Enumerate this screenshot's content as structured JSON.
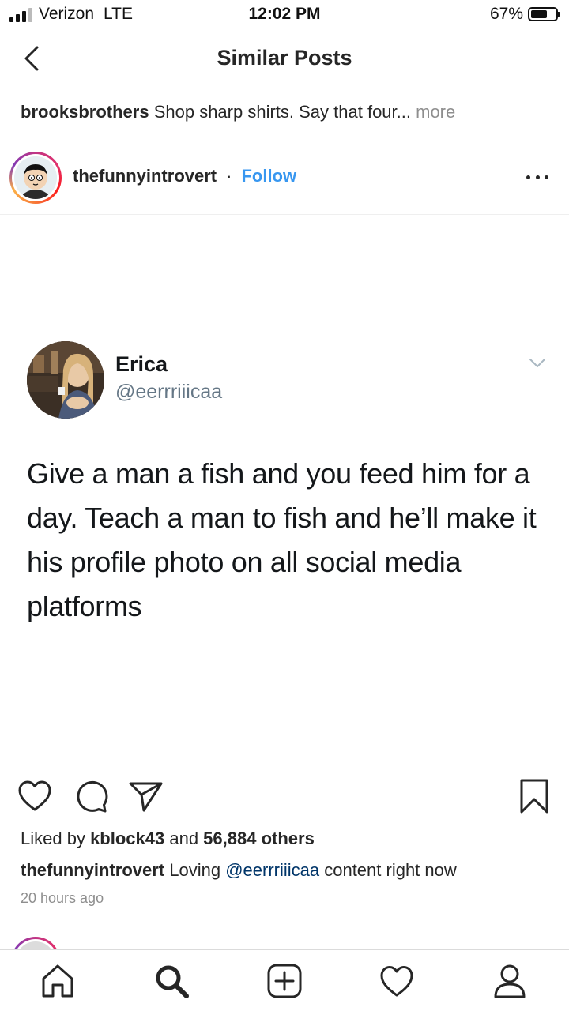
{
  "status_bar": {
    "carrier": "Verizon",
    "network": "LTE",
    "time": "12:02 PM",
    "battery": "67%",
    "battery_level": 0.67
  },
  "header": {
    "title": "Similar Posts",
    "back_icon": "chevron-left-icon"
  },
  "top_caption": {
    "username": "brooksbrothers",
    "text": " Shop sharp shirts. Say that four...",
    "more": " more"
  },
  "post": {
    "username": "thefunnyintrovert",
    "separator": "·",
    "follow_label": "Follow",
    "tweet": {
      "name": "Erica",
      "handle": "@eerrriiicaa",
      "text": "Give a man a fish and you feed him for a day. Teach a man to fish and he’ll make it his profile photo on all social media platforms"
    },
    "likes": {
      "prefix": "Liked by ",
      "user": "kblock43",
      "middle": " and ",
      "others": "56,884 others"
    },
    "caption": {
      "username": "thefunnyintrovert",
      "before": " Loving ",
      "mention": "@eerrriiicaa",
      "after": " content right now"
    },
    "timestamp": "20 hours ago"
  },
  "actions": [
    "heart-icon",
    "comment-icon",
    "share-icon",
    "bookmark-icon"
  ],
  "tab_bar": [
    "home-icon",
    "search-icon",
    "add-post-icon",
    "activity-heart-icon",
    "profile-icon"
  ],
  "colors": {
    "link_blue": "#3897f0",
    "mention": "#003569",
    "muted": "#8e8e8e",
    "text": "#262626"
  }
}
